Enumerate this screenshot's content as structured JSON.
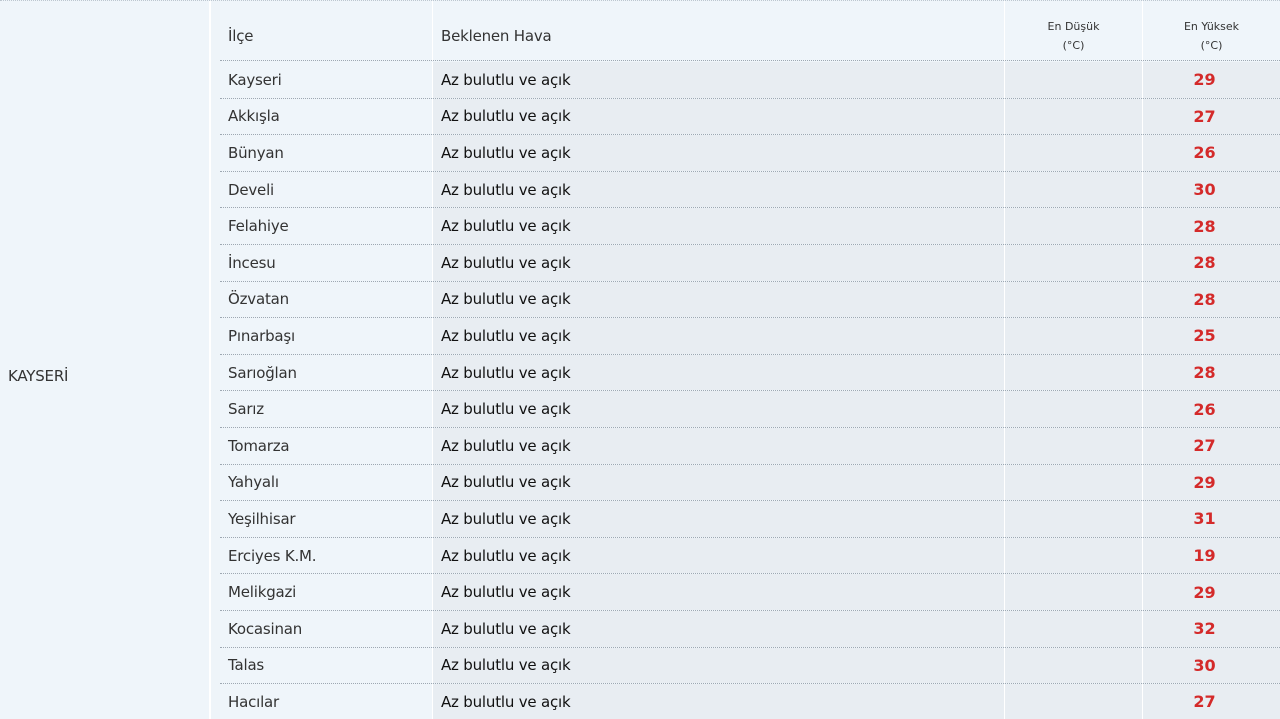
{
  "province": "KAYSERİ",
  "header": {
    "ilce": "İlçe",
    "beklenen_hava": "Beklenen Hava",
    "en_dusuk_line1": "En Düşük",
    "en_dusuk_line2": "(°C)",
    "en_yuksek_line1": "En Yüksek",
    "en_yuksek_line2": "(°C)"
  },
  "rows": [
    {
      "ilce": "Kayseri",
      "hava": "Az bulutlu ve açık",
      "dusuk": "",
      "yuksek": "29"
    },
    {
      "ilce": "Akkışla",
      "hava": "Az bulutlu ve açık",
      "dusuk": "",
      "yuksek": "27"
    },
    {
      "ilce": "Bünyan",
      "hava": "Az bulutlu ve açık",
      "dusuk": "",
      "yuksek": "26"
    },
    {
      "ilce": "Develi",
      "hava": "Az bulutlu ve açık",
      "dusuk": "",
      "yuksek": "30"
    },
    {
      "ilce": "Felahiye",
      "hava": "Az bulutlu ve açık",
      "dusuk": "",
      "yuksek": "28"
    },
    {
      "ilce": "İncesu",
      "hava": "Az bulutlu ve açık",
      "dusuk": "",
      "yuksek": "28"
    },
    {
      "ilce": "Özvatan",
      "hava": "Az bulutlu ve açık",
      "dusuk": "",
      "yuksek": "28"
    },
    {
      "ilce": "Pınarbaşı",
      "hava": "Az bulutlu ve açık",
      "dusuk": "",
      "yuksek": "25"
    },
    {
      "ilce": "Sarıoğlan",
      "hava": "Az bulutlu ve açık",
      "dusuk": "",
      "yuksek": "28"
    },
    {
      "ilce": "Sarız",
      "hava": "Az bulutlu ve açık",
      "dusuk": "",
      "yuksek": "26"
    },
    {
      "ilce": "Tomarza",
      "hava": "Az bulutlu ve açık",
      "dusuk": "",
      "yuksek": "27"
    },
    {
      "ilce": "Yahyalı",
      "hava": "Az bulutlu ve açık",
      "dusuk": "",
      "yuksek": "29"
    },
    {
      "ilce": "Yeşilhisar",
      "hava": "Az bulutlu ve açık",
      "dusuk": "",
      "yuksek": "31"
    },
    {
      "ilce": "Erciyes K.M.",
      "hava": "Az bulutlu ve açık",
      "dusuk": "",
      "yuksek": "19"
    },
    {
      "ilce": "Melikgazi",
      "hava": "Az bulutlu ve açık",
      "dusuk": "",
      "yuksek": "29"
    },
    {
      "ilce": "Kocasinan",
      "hava": "Az bulutlu ve açık",
      "dusuk": "",
      "yuksek": "32"
    },
    {
      "ilce": "Talas",
      "hava": "Az bulutlu ve açık",
      "dusuk": "",
      "yuksek": "30"
    },
    {
      "ilce": "Hacılar",
      "hava": "Az bulutlu ve açık",
      "dusuk": "",
      "yuksek": "27"
    }
  ],
  "colors": {
    "background": "#eff5fa",
    "cell_background": "#e8edf2",
    "max_temp": "#d42a2a",
    "text": "#333333"
  }
}
